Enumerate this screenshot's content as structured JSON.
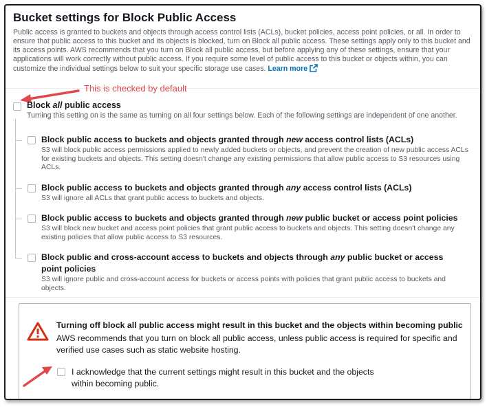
{
  "panel": {
    "title": "Bucket settings for Block Public Access",
    "description": "Public access is granted to buckets and objects through access control lists (ACLs), bucket policies, access point policies, or all. In order to ensure that public access to this bucket and its objects is blocked, turn on Block all public access. These settings apply only to this bucket and its access points. AWS recommends that you turn on Block all public access, but before applying any of these settings, ensure that your applications will work correctly without public access. If you require some level of public access to this bucket or objects within, you can customize the individual settings below to suit your specific storage use cases.",
    "learn_more": "Learn more"
  },
  "annotation": {
    "text": "This is checked by default",
    "color": "#e0484e"
  },
  "block_all": {
    "label_pre": "Block ",
    "label_em": "all",
    "label_post": " public access",
    "description": "Turning this setting on is the same as turning on all four settings below. Each of the following settings are independent of one another.",
    "checked": false
  },
  "options": [
    {
      "title_pre": "Block public access to buckets and objects granted through ",
      "title_em": "new",
      "title_post": " access control lists (ACLs)",
      "description": "S3 will block public access permissions applied to newly added buckets or objects, and prevent the creation of new public access ACLs for existing buckets and objects. This setting doesn't change any existing permissions that allow public access to S3 resources using ACLs.",
      "checked": false
    },
    {
      "title_pre": "Block public access to buckets and objects granted through ",
      "title_em": "any",
      "title_post": " access control lists (ACLs)",
      "description": "S3 will ignore all ACLs that grant public access to buckets and objects.",
      "checked": false
    },
    {
      "title_pre": "Block public access to buckets and objects granted through ",
      "title_em": "new",
      "title_post": " public bucket or access point policies",
      "description": "S3 will block new bucket and access point policies that grant public access to buckets and objects. This setting doesn't change any existing policies that allow public access to S3 resources.",
      "checked": false
    },
    {
      "title_pre": "Block public and cross-account access to buckets and objects through ",
      "title_em": "any",
      "title_post": " public bucket or access point policies",
      "description": "S3 will ignore public and cross-account access for buckets or access points with policies that grant public access to buckets and objects.",
      "checked": false
    }
  ],
  "warning": {
    "title": "Turning off block all public access might result in this bucket and the objects within becoming public",
    "body": "AWS recommends that you turn on block all public access, unless public access is required for specific and verified use cases such as static website hosting.",
    "acknowledge_label": "I acknowledge that the current settings might result in this bucket and the objects within becoming public.",
    "acknowledge_checked": false
  },
  "colors": {
    "link": "#0073bb",
    "text": "#16191f",
    "secondary_text": "#545b64",
    "warning_icon": "#d13212",
    "annotation_arrow": "#e0484e"
  }
}
